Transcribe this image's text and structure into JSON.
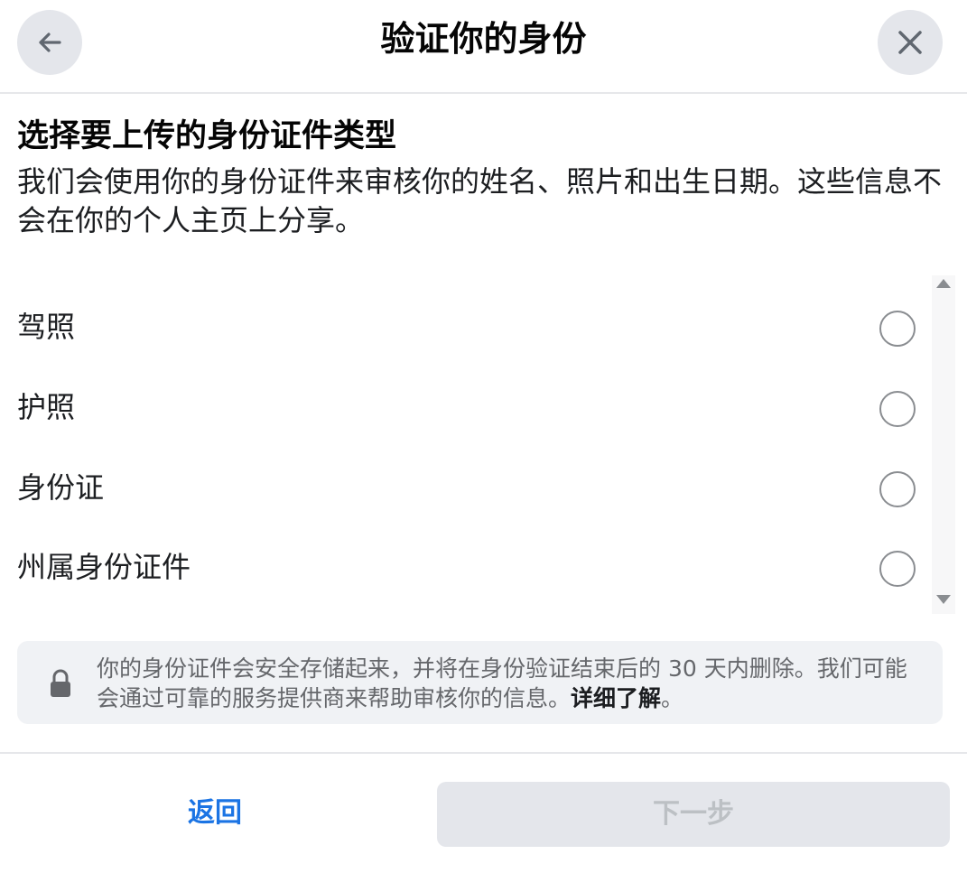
{
  "header": {
    "title": "验证你的身份",
    "back_icon": "arrow-left-icon",
    "close_icon": "close-icon"
  },
  "intro": {
    "title": "选择要上传的身份证件类型",
    "description": "我们会使用你的身份证件来审核你的姓名、照片和出生日期。这些信息不会在你的个人主页上分享。"
  },
  "options": [
    {
      "label": "驾照",
      "selected": false
    },
    {
      "label": "护照",
      "selected": false
    },
    {
      "label": "身份证",
      "selected": false
    },
    {
      "label": "州属身份证件",
      "selected": false
    }
  ],
  "notice": {
    "icon": "lock-icon",
    "text": "你的身份证件会安全存储起来，并将在身份验证结束后的 30 天内删除。我们可能会通过可靠的服务提供商来帮助审核你的信息。",
    "link": "详细了解",
    "suffix": "。"
  },
  "footer": {
    "back_label": "返回",
    "next_label": "下一步",
    "next_disabled": true
  },
  "colors": {
    "accent": "#1b74e4",
    "button_disabled_bg": "#e4e6eb",
    "notice_bg": "#f0f2f5"
  }
}
